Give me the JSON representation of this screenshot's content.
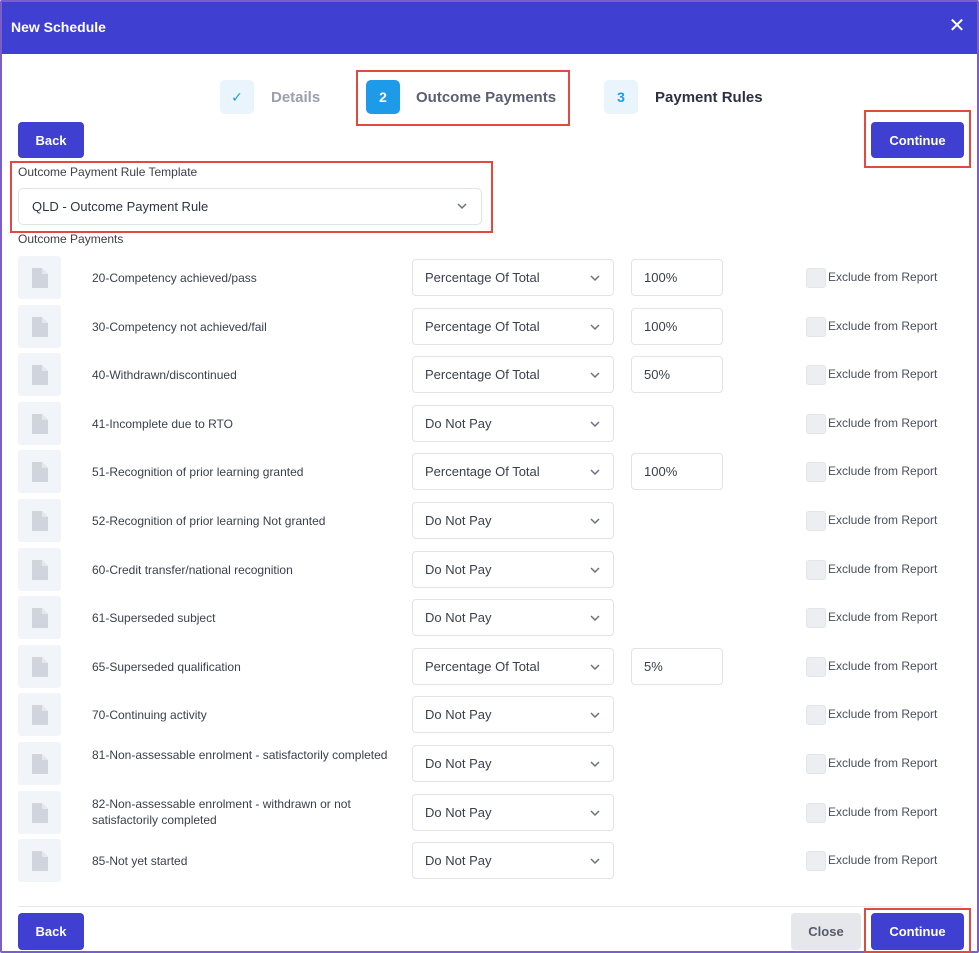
{
  "header": {
    "title": "New Schedule",
    "close_icon": "close-icon"
  },
  "steps": [
    {
      "badge": "✓",
      "label": "Details",
      "state": "completed"
    },
    {
      "badge": "2",
      "label": "Outcome Payments",
      "state": "active"
    },
    {
      "badge": "3",
      "label": "Payment Rules",
      "state": "upcoming"
    }
  ],
  "buttons": {
    "back": "Back",
    "continue": "Continue",
    "close": "Close"
  },
  "template": {
    "label": "Outcome Payment Rule Template",
    "value": "QLD - Outcome Payment Rule"
  },
  "outcomes": {
    "label": "Outcome Payments",
    "exclude_label": "Exclude from Report",
    "rows": [
      {
        "label": "20-Competency achieved/pass",
        "method": "Percentage Of Total",
        "amount": "100%"
      },
      {
        "label": "30-Competency not achieved/fail",
        "method": "Percentage Of Total",
        "amount": "100%"
      },
      {
        "label": "40-Withdrawn/discontinued",
        "method": "Percentage Of Total",
        "amount": "50%"
      },
      {
        "label": "41-Incomplete due to RTO",
        "method": "Do Not Pay",
        "amount": null
      },
      {
        "label": "51-Recognition of prior learning granted",
        "method": "Percentage Of Total",
        "amount": "100%"
      },
      {
        "label": "52-Recognition of prior learning Not granted",
        "method": "Do Not Pay",
        "amount": null
      },
      {
        "label": "60-Credit transfer/national recognition",
        "method": "Do Not Pay",
        "amount": null
      },
      {
        "label": "61-Superseded subject",
        "method": "Do Not Pay",
        "amount": null
      },
      {
        "label": "65-Superseded qualification",
        "method": "Percentage Of Total",
        "amount": "5%"
      },
      {
        "label": "70-Continuing activity",
        "method": "Do Not Pay",
        "amount": null
      },
      {
        "label": "81-Non-assessable enrolment - satisfactorily completed",
        "method": "Do Not Pay",
        "amount": null
      },
      {
        "label": "82-Non-assessable enrolment - withdrawn or not satisfactorily completed",
        "method": "Do Not Pay",
        "amount": null
      },
      {
        "label": "85-Not yet started",
        "method": "Do Not Pay",
        "amount": null
      }
    ]
  },
  "colors": {
    "primary": "#3f3fd1",
    "step_active": "#1e9be8",
    "highlight": "#e04a3f"
  }
}
